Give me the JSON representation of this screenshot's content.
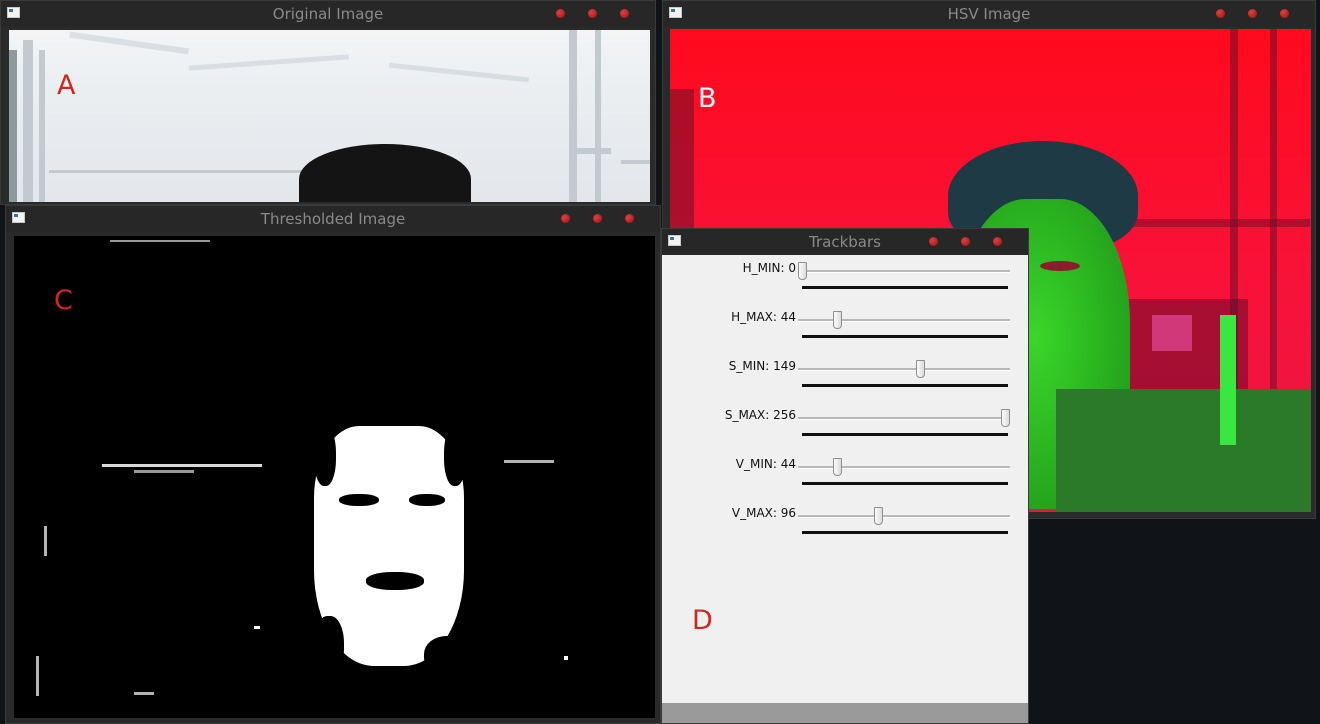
{
  "windows": {
    "original": {
      "title": "Original Image",
      "marker": "A"
    },
    "hsv": {
      "title": "HSV Image",
      "marker": "B"
    },
    "thresholded": {
      "title": "Thresholded Image",
      "marker": "C"
    },
    "trackbars": {
      "title": "Trackbars",
      "marker": "D"
    }
  },
  "trackbars": [
    {
      "name": "H_MIN",
      "label": "H_MIN: 0",
      "value": 0,
      "max": 256
    },
    {
      "name": "H_MAX",
      "label": "H_MAX: 44",
      "value": 44,
      "max": 256
    },
    {
      "name": "S_MIN",
      "label": "S_MIN: 149",
      "value": 149,
      "max": 256
    },
    {
      "name": "S_MAX",
      "label": "S_MAX: 256",
      "value": 256,
      "max": 256
    },
    {
      "name": "V_MIN",
      "label": "V_MIN: 44",
      "value": 44,
      "max": 256
    },
    {
      "name": "V_MAX",
      "label": "V_MAX: 96",
      "value": 96,
      "max": 256
    }
  ],
  "colors": {
    "marker_red": "#d0261c",
    "marker_white": "#ffffff",
    "window_button": "#c81e1e",
    "hsv_background": "#ff0a1e",
    "hsv_face": "#33c428"
  }
}
